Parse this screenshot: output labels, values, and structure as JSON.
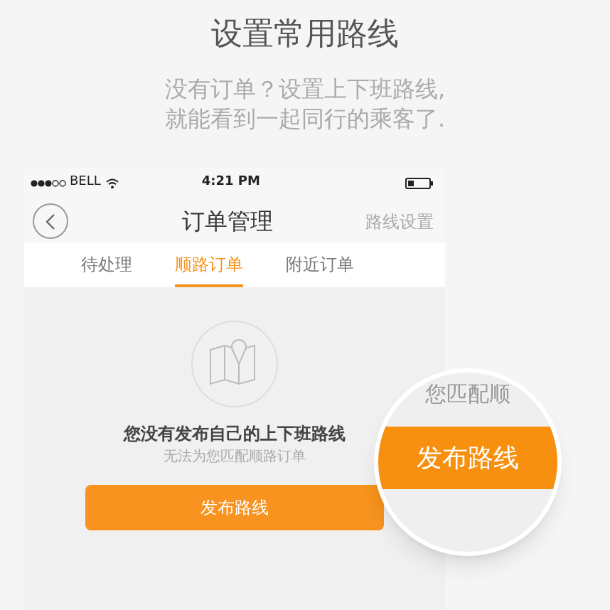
{
  "header": {
    "title": "设置常用路线",
    "subtitle_lines": [
      "没有订单？设置上下班路线,",
      "就能看到一起同行的乘客了."
    ]
  },
  "status_bar": {
    "carrier": "BELL",
    "time": "4:21 PM"
  },
  "nav_bar": {
    "title": "订单管理",
    "action": "路线设置"
  },
  "tabs": [
    {
      "label": "待处理",
      "selected": false
    },
    {
      "label": "顺路订单",
      "selected": true
    },
    {
      "label": "附近订单",
      "selected": false
    }
  ],
  "empty_state": {
    "message": "您没有发布自己的上下班路线",
    "hint": "无法为您匹配顺路订单",
    "button": "发布路线"
  },
  "magnifier": {
    "partial_text": "您匹配顺",
    "button": "发布路线"
  }
}
